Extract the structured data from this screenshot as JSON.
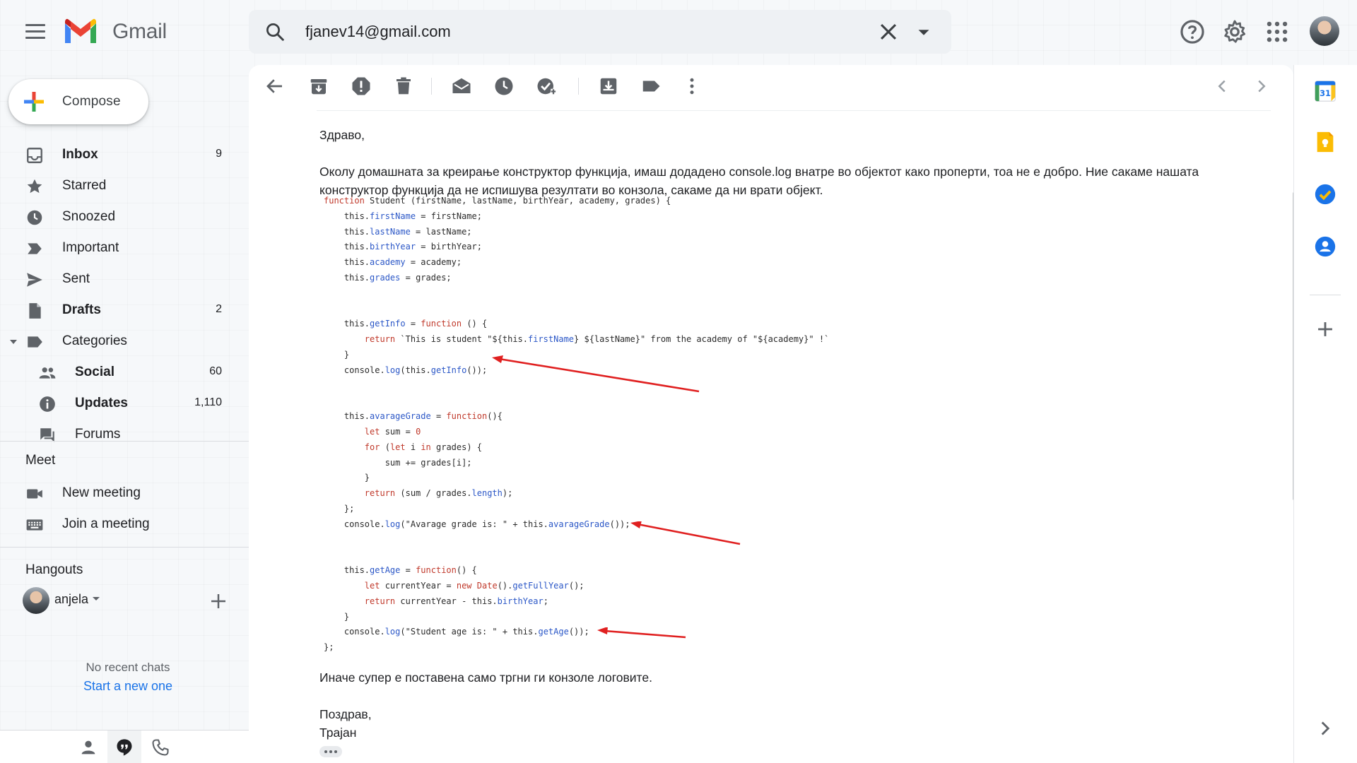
{
  "app": {
    "name": "Gmail"
  },
  "search": {
    "value": "fjanev14@gmail.com"
  },
  "compose": {
    "label": "Compose"
  },
  "nav": {
    "items": [
      {
        "label": "Inbox",
        "count": "9",
        "bold": true,
        "icon": "inbox-icon"
      },
      {
        "label": "Starred",
        "count": "",
        "bold": false,
        "icon": "star-icon"
      },
      {
        "label": "Snoozed",
        "count": "",
        "bold": false,
        "icon": "clock-icon"
      },
      {
        "label": "Important",
        "count": "",
        "bold": false,
        "icon": "important-icon"
      },
      {
        "label": "Sent",
        "count": "",
        "bold": false,
        "icon": "send-icon"
      },
      {
        "label": "Drafts",
        "count": "2",
        "bold": true,
        "icon": "draft-icon"
      },
      {
        "label": "Categories",
        "count": "",
        "bold": false,
        "icon": "label-icon"
      },
      {
        "label": "Social",
        "count": "60",
        "bold": true,
        "icon": "people-icon"
      },
      {
        "label": "Updates",
        "count": "1,110",
        "bold": true,
        "icon": "info-icon"
      },
      {
        "label": "Forums",
        "count": "",
        "bold": false,
        "icon": "forum-icon"
      }
    ]
  },
  "meet": {
    "title": "Meet",
    "new_meeting": "New meeting",
    "join_meeting": "Join a meeting"
  },
  "hangouts": {
    "title": "Hangouts",
    "user": "anjela",
    "no_recent": "No recent chats",
    "start_new": "Start a new one"
  },
  "email": {
    "greeting": "Здраво,",
    "paragraph": "Околу домашната за креирање конструктор функција, имаш додадено console.log внатре во објектот како проперти, тоа не е добро. Ние сакаме нашата конструктор функција да не испишува резултати во конзола, сакаме да ни врати објект.",
    "code_lines": [
      "function Student (firstName, lastName, birthYear, academy, grades) {",
      "    this.firstName = firstName;",
      "    this.lastName = lastName;",
      "    this.birthYear = birthYear;",
      "    this.academy = academy;",
      "    this.grades = grades;",
      "",
      "",
      "    this.getInfo = function () {",
      "        return `This is student \"${this.firstName} ${lastName}\" from the academy of \"${academy}\" !`",
      "    }",
      "    console.log(this.getInfo());",
      "",
      "",
      "    this.avarageGrade = function(){",
      "        let sum = 0",
      "        for (let i in grades) {",
      "            sum += grades[i];",
      "        }",
      "        return (sum / grades.length);",
      "    };",
      "    console.log(\"Avarage grade is: \" + this.avarageGrade());",
      "",
      "",
      "    this.getAge = function() {",
      "        let currentYear = new Date().getFullYear();",
      "        return currentYear - this.birthYear;",
      "    }",
      "    console.log(\"Student age is: \" + this.getAge());",
      "};"
    ],
    "closing_note": "Иначе супер е поставена само тргни ги конзоле логовите.",
    "signoff": "Поздрав,",
    "signature": "Трајан"
  },
  "colors": {
    "accent_blue": "#1a73e8",
    "annotation_red": "#e02020",
    "code_keyword": "#c0392b",
    "code_property": "#2b57c7"
  }
}
